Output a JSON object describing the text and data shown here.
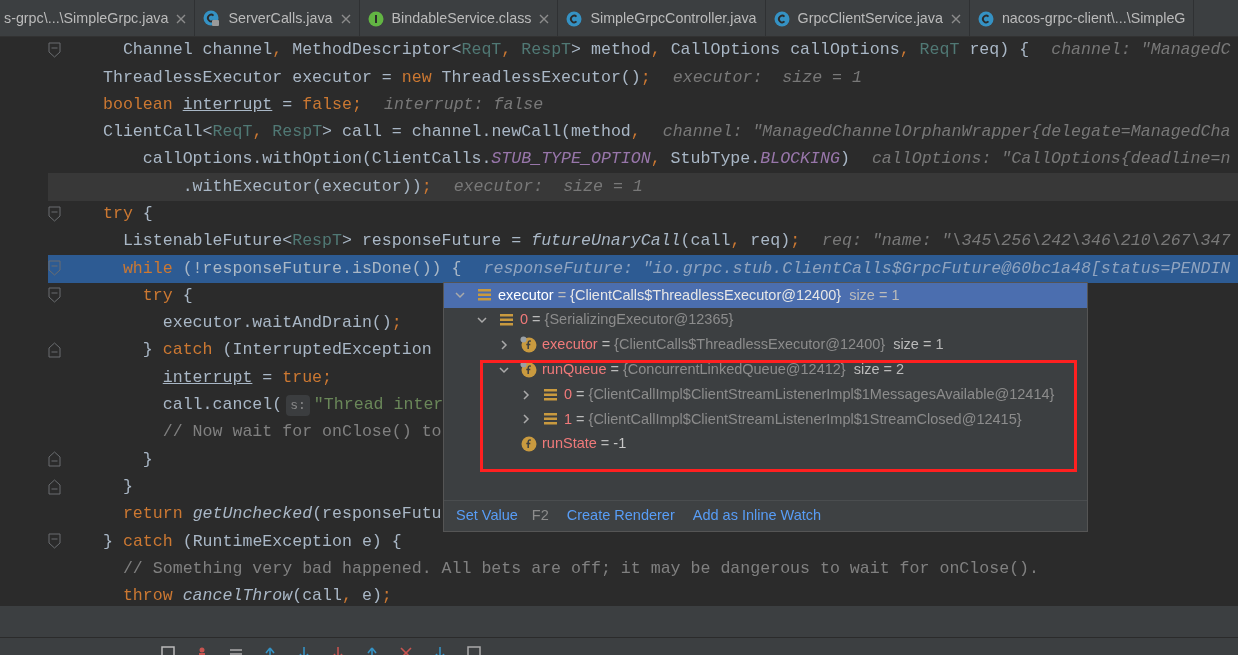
{
  "tabs": [
    {
      "label": "s-grpc\\...\\SimpleGrpc.java",
      "kind": "none",
      "closable": true
    },
    {
      "label": "ServerCalls.java",
      "kind": "locked",
      "closable": true
    },
    {
      "label": "BindableService.class",
      "kind": "interface",
      "closable": true
    },
    {
      "label": "SimpleGrpcController.java",
      "kind": "class",
      "closable": false
    },
    {
      "label": "GrpcClientService.java",
      "kind": "class",
      "closable": true
    },
    {
      "label": "nacos-grpc-client\\...\\SimpleG",
      "kind": "class",
      "closable": false
    }
  ],
  "code": {
    "lines": [
      {
        "fold_start": true,
        "fold_end": false,
        "caret_line": false,
        "execution_point": false,
        "parts": [
          {
            "kind": "code",
            "tokens": [
              {
                "kind": "plain",
                "text": "  Channel channel"
              },
              {
                "kind": "keyword",
                "text": ", "
              },
              {
                "kind": "plain",
                "text": "MethodDescriptor<"
              },
              {
                "kind": "typeparam",
                "text": "ReqT"
              },
              {
                "kind": "keyword",
                "text": ", "
              },
              {
                "kind": "typeparam",
                "text": "RespT"
              },
              {
                "kind": "plain",
                "text": "> method"
              },
              {
                "kind": "keyword",
                "text": ", "
              },
              {
                "kind": "plain",
                "text": "CallOptions callOptions"
              },
              {
                "kind": "keyword",
                "text": ", "
              },
              {
                "kind": "typeparam",
                "text": "ReqT"
              },
              {
                "kind": "plain",
                "text": " req) {"
              }
            ]
          },
          {
            "kind": "hint",
            "text": "channel: \"ManagedC"
          }
        ]
      },
      {
        "fold_start": false,
        "fold_end": false,
        "caret_line": false,
        "execution_point": false,
        "parts": [
          {
            "kind": "code",
            "tokens": [
              {
                "kind": "plain",
                "text": "ThreadlessExecutor executor = "
              },
              {
                "kind": "keyword",
                "text": "new "
              },
              {
                "kind": "plain",
                "text": "ThreadlessExecutor()"
              },
              {
                "kind": "keyword",
                "text": ";"
              }
            ]
          },
          {
            "kind": "hint",
            "text": "executor:  size = 1"
          }
        ]
      },
      {
        "fold_start": false,
        "fold_end": false,
        "caret_line": false,
        "execution_point": false,
        "parts": [
          {
            "kind": "code",
            "tokens": [
              {
                "kind": "keyword",
                "text": "boolean "
              },
              {
                "kind": "reassigned",
                "text": "interrupt"
              },
              {
                "kind": "plain",
                "text": " = "
              },
              {
                "kind": "keyword",
                "text": "false;"
              }
            ]
          },
          {
            "kind": "hint",
            "text": "interrupt: false"
          }
        ]
      },
      {
        "fold_start": false,
        "fold_end": false,
        "caret_line": false,
        "execution_point": false,
        "parts": [
          {
            "kind": "code",
            "tokens": [
              {
                "kind": "plain",
                "text": "ClientCall<"
              },
              {
                "kind": "typeparam",
                "text": "ReqT"
              },
              {
                "kind": "keyword",
                "text": ", "
              },
              {
                "kind": "typeparam",
                "text": "RespT"
              },
              {
                "kind": "plain",
                "text": "> call = channel.newCall(method"
              },
              {
                "kind": "keyword",
                "text": ","
              }
            ]
          },
          {
            "kind": "hint",
            "text": "channel: \"ManagedChannelOrphanWrapper{delegate=ManagedCha"
          }
        ]
      },
      {
        "fold_start": false,
        "fold_end": false,
        "caret_line": false,
        "execution_point": false,
        "parts": [
          {
            "kind": "code",
            "tokens": [
              {
                "kind": "plain",
                "text": "    callOptions.withOption(ClientCalls."
              },
              {
                "kind": "constant",
                "text": "STUB_TYPE_OPTION"
              },
              {
                "kind": "keyword",
                "text": ", "
              },
              {
                "kind": "plain",
                "text": "StubType."
              },
              {
                "kind": "constant",
                "text": "BLOCKING"
              },
              {
                "kind": "plain",
                "text": ")"
              }
            ]
          },
          {
            "kind": "hint",
            "text": "callOptions: \"CallOptions{deadline=n"
          }
        ]
      },
      {
        "fold_start": false,
        "fold_end": false,
        "caret_line": true,
        "execution_point": false,
        "parts": [
          {
            "kind": "code",
            "tokens": [
              {
                "kind": "plain",
                "text": "        .withExecutor(executor))"
              },
              {
                "kind": "keyword",
                "text": ";"
              }
            ]
          },
          {
            "kind": "hint",
            "text": "executor:  size = 1"
          }
        ]
      },
      {
        "fold_start": true,
        "fold_end": false,
        "caret_line": false,
        "execution_point": false,
        "parts": [
          {
            "kind": "code",
            "tokens": [
              {
                "kind": "keyword",
                "text": "try "
              },
              {
                "kind": "plain",
                "text": "{"
              }
            ]
          }
        ]
      },
      {
        "fold_start": false,
        "fold_end": false,
        "caret_line": false,
        "execution_point": false,
        "parts": [
          {
            "kind": "code",
            "tokens": [
              {
                "kind": "plain",
                "text": "  ListenableFuture<"
              },
              {
                "kind": "typeparam",
                "text": "RespT"
              },
              {
                "kind": "plain",
                "text": "> responseFuture = "
              },
              {
                "kind": "static_call",
                "text": "futureUnaryCall"
              },
              {
                "kind": "plain",
                "text": "(call"
              },
              {
                "kind": "keyword",
                "text": ", "
              },
              {
                "kind": "plain",
                "text": "req)"
              },
              {
                "kind": "keyword",
                "text": ";"
              }
            ]
          },
          {
            "kind": "hint",
            "text": "req: \"name: \"\\345\\256\\242\\346\\210\\267\\347"
          }
        ]
      },
      {
        "fold_start": true,
        "fold_end": false,
        "caret_line": false,
        "execution_point": true,
        "parts": [
          {
            "kind": "code",
            "tokens": [
              {
                "kind": "keyword",
                "text": "  while "
              },
              {
                "kind": "plain",
                "text": "(!responseFuture.isDone()) {"
              }
            ]
          },
          {
            "kind": "hint",
            "text": "responseFuture: \"io.grpc.stub.ClientCalls$GrpcFuture@60bc1a48[status=PENDIN"
          }
        ]
      },
      {
        "fold_start": true,
        "fold_end": false,
        "caret_line": false,
        "execution_point": false,
        "parts": [
          {
            "kind": "code",
            "tokens": [
              {
                "kind": "keyword",
                "text": "    try "
              },
              {
                "kind": "plain",
                "text": "{"
              }
            ]
          }
        ]
      },
      {
        "fold_start": false,
        "fold_end": false,
        "caret_line": false,
        "execution_point": false,
        "parts": [
          {
            "kind": "code",
            "tokens": [
              {
                "kind": "plain",
                "text": "      executor.waitAndDrain()"
              },
              {
                "kind": "keyword",
                "text": ";"
              }
            ]
          }
        ]
      },
      {
        "fold_start": false,
        "fold_end": true,
        "caret_line": false,
        "execution_point": false,
        "parts": [
          {
            "kind": "code",
            "tokens": [
              {
                "kind": "plain",
                "text": "    } "
              },
              {
                "kind": "keyword",
                "text": "catch "
              },
              {
                "kind": "plain",
                "text": "(InterruptedException"
              }
            ]
          }
        ]
      },
      {
        "fold_start": false,
        "fold_end": false,
        "caret_line": false,
        "execution_point": false,
        "parts": [
          {
            "kind": "code",
            "tokens": [
              {
                "kind": "reassigned",
                "text": "      interrupt"
              },
              {
                "kind": "plain",
                "text": " = "
              },
              {
                "kind": "keyword",
                "text": "true;"
              }
            ]
          }
        ]
      },
      {
        "fold_start": false,
        "fold_end": false,
        "caret_line": false,
        "execution_point": false,
        "parts": [
          {
            "kind": "code",
            "tokens": [
              {
                "kind": "plain",
                "text": "      call.cancel("
              }
            ]
          },
          {
            "kind": "param",
            "text": "s:"
          },
          {
            "kind": "code",
            "tokens": [
              {
                "kind": "string",
                "text": "\"Thread inter"
              }
            ]
          }
        ]
      },
      {
        "fold_start": false,
        "fold_end": false,
        "caret_line": false,
        "execution_point": false,
        "parts": [
          {
            "kind": "code",
            "tokens": [
              {
                "kind": "comment",
                "text": "      // Now wait for onClose() to"
              }
            ]
          }
        ]
      },
      {
        "fold_start": false,
        "fold_end": true,
        "caret_line": false,
        "execution_point": false,
        "parts": [
          {
            "kind": "code",
            "tokens": [
              {
                "kind": "plain",
                "text": "    }"
              }
            ]
          }
        ]
      },
      {
        "fold_start": false,
        "fold_end": true,
        "caret_line": false,
        "execution_point": false,
        "parts": [
          {
            "kind": "code",
            "tokens": [
              {
                "kind": "plain",
                "text": "  }"
              }
            ]
          }
        ]
      },
      {
        "fold_start": false,
        "fold_end": false,
        "caret_line": false,
        "execution_point": false,
        "parts": [
          {
            "kind": "code",
            "tokens": [
              {
                "kind": "keyword",
                "text": "  return "
              },
              {
                "kind": "static_call",
                "text": "getUnchecked"
              },
              {
                "kind": "plain",
                "text": "(responseFutu"
              }
            ]
          }
        ]
      },
      {
        "fold_start": true,
        "fold_end": false,
        "caret_line": false,
        "execution_point": false,
        "parts": [
          {
            "kind": "code",
            "tokens": [
              {
                "kind": "plain",
                "text": "} "
              },
              {
                "kind": "keyword",
                "text": "catch "
              },
              {
                "kind": "plain",
                "text": "(RuntimeException e) {"
              }
            ]
          }
        ]
      },
      {
        "fold_start": false,
        "fold_end": false,
        "caret_line": false,
        "execution_point": false,
        "parts": [
          {
            "kind": "code",
            "tokens": [
              {
                "kind": "comment",
                "text": "  // Something very bad happened. All bets are off; it may be dangerous to wait for onClose()."
              }
            ]
          }
        ]
      },
      {
        "fold_start": false,
        "fold_end": false,
        "caret_line": false,
        "execution_point": false,
        "parts": [
          {
            "kind": "code",
            "tokens": [
              {
                "kind": "keyword",
                "text": "  throw "
              },
              {
                "kind": "static_call",
                "text": "cancelThrow"
              },
              {
                "kind": "plain",
                "text": "(call"
              },
              {
                "kind": "keyword",
                "text": ", "
              },
              {
                "kind": "plain",
                "text": "e)"
              },
              {
                "kind": "keyword",
                "text": ";"
              }
            ]
          }
        ]
      }
    ]
  },
  "popup": {
    "tree": [
      {
        "name": "executor",
        "operator": "=",
        "value": "{ClientCalls$ThreadlessExecutor@12400}",
        "primitive": false,
        "size": "size = 1",
        "kind": "array",
        "final": false,
        "expanded": true,
        "selected": true,
        "children": [
          {
            "name": "0",
            "operator": "=",
            "value": "{SerializingExecutor@12365}",
            "primitive": false,
            "kind": "array",
            "final": false,
            "expanded": true,
            "selected": false,
            "children": [
              {
                "name": "executor",
                "operator": "=",
                "value": "{ClientCalls$ThreadlessExecutor@12400}",
                "primitive": false,
                "size": "size = 1",
                "kind": "field",
                "final": true,
                "expanded": false,
                "selected": false
              },
              {
                "name": "runQueue",
                "operator": "=",
                "value": "{ConcurrentLinkedQueue@12412}",
                "primitive": false,
                "size": "size = 2",
                "kind": "field",
                "final": true,
                "expanded": true,
                "selected": false,
                "children": [
                  {
                    "name": "0",
                    "operator": "=",
                    "value": "{ClientCallImpl$ClientStreamListenerImpl$1MessagesAvailable@12414}",
                    "primitive": false,
                    "kind": "array",
                    "final": false,
                    "expanded": false,
                    "selected": false
                  },
                  {
                    "name": "1",
                    "operator": "=",
                    "value": "{ClientCallImpl$ClientStreamListenerImpl$1StreamClosed@12415}",
                    "primitive": false,
                    "kind": "array",
                    "final": false,
                    "expanded": false,
                    "selected": false
                  }
                ]
              },
              {
                "name": "runState",
                "operator": "=",
                "value": "-1",
                "primitive": true,
                "kind": "field",
                "final": false,
                "selected": false
              }
            ]
          }
        ]
      }
    ],
    "annotation": {
      "color": "#ff2020"
    },
    "actions": [
      {
        "label": "Set Value",
        "shortcut": "F2"
      },
      {
        "label": "Create Renderer"
      },
      {
        "label": "Add as Inline Watch"
      }
    ]
  }
}
